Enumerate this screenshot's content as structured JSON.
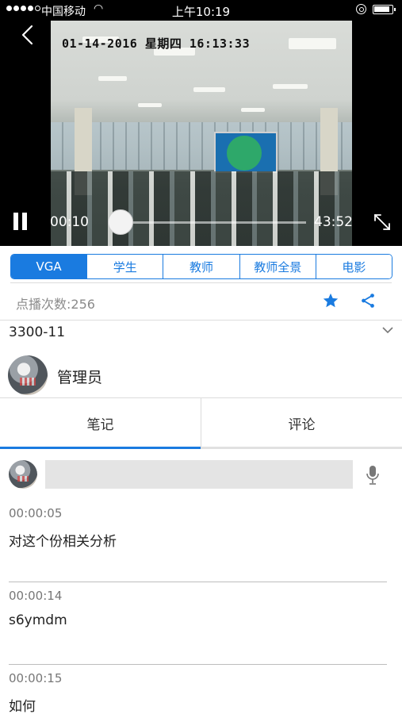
{
  "status_bar": {
    "carrier": "中国移动",
    "time": "上午10:19"
  },
  "player": {
    "overlay_timestamp": "01-14-2016 星期四 16:13:33",
    "current_time": "00:10",
    "total_time": "43:52",
    "progress": 0.004
  },
  "quality_tabs": [
    {
      "label": "VGA",
      "active": true
    },
    {
      "label": "学生",
      "active": false
    },
    {
      "label": "教师",
      "active": false
    },
    {
      "label": "教师全景",
      "active": false
    },
    {
      "label": "电影",
      "active": false
    }
  ],
  "stats": {
    "plays": "点播次数:256"
  },
  "course": {
    "title": "3300-11",
    "author": "管理员"
  },
  "content_tabs": {
    "notes": "笔记",
    "comments": "评论"
  },
  "compose": {
    "placeholder": ""
  },
  "notes": [
    {
      "time": "00:00:05",
      "text": "对这个份相关分析"
    },
    {
      "time": "00:00:14",
      "text": "s6ymdm"
    },
    {
      "time": "00:00:15",
      "text": "如何"
    }
  ],
  "colors": {
    "accent": "#1a7be0",
    "divider": "#dcdcdc",
    "input_bg": "#e4e4e4"
  },
  "icons": [
    "back-icon",
    "pause-icon",
    "fullscreen-icon",
    "star-icon",
    "share-icon",
    "chevron-down-icon",
    "mic-icon"
  ]
}
